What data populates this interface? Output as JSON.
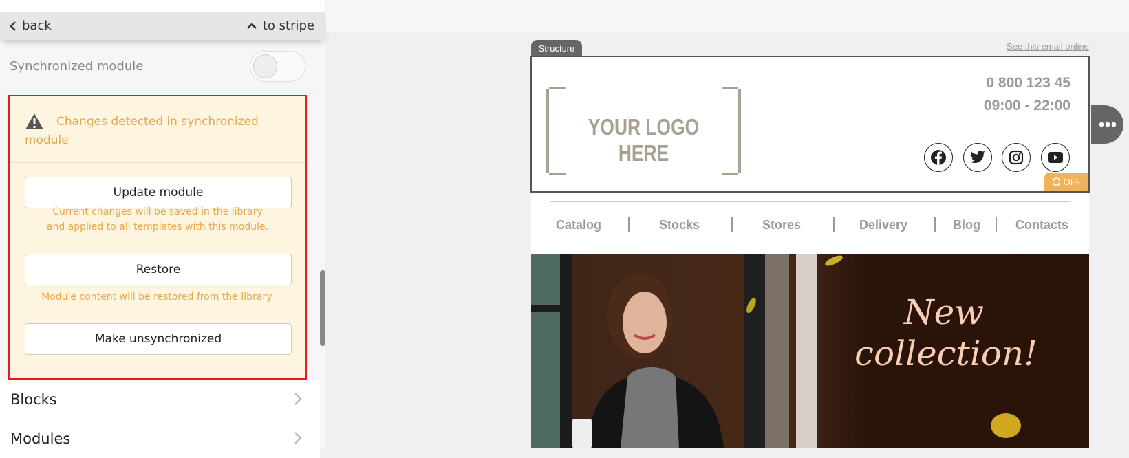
{
  "panel": {
    "back_label": "back",
    "to_stripe_label": "to stripe",
    "sync_label": "Synchronized module",
    "sync_enabled": false,
    "warning": {
      "title": "Changes detected in synchronized module",
      "update_label": "Update module",
      "update_desc": "Current changes will be saved in the library and applied to all templates with this module.",
      "restore_label": "Restore",
      "restore_desc": "Module content will be restored from the library.",
      "unsync_label": "Make unsynchronized"
    },
    "sections": [
      {
        "label": "Blocks"
      },
      {
        "label": "Modules"
      }
    ],
    "colors": {
      "warning_text": "#e2a94a",
      "highlight_border": "#e31c23",
      "warning_bg": "#fdf5e0"
    }
  },
  "email": {
    "structure_label": "Structure",
    "view_online": "See this email online",
    "logo_text": "YOUR LOGO HERE",
    "phone": "0 800 123 45",
    "hours": "09:00 - 22:00",
    "social": [
      "facebook-icon",
      "twitter-icon",
      "instagram-icon",
      "youtube-icon"
    ],
    "sync_badge": "OFF",
    "nav": [
      "Catalog",
      "Stocks",
      "Stores",
      "Delivery",
      "Blog",
      "Contacts"
    ],
    "hero_text_line1": "New",
    "hero_text_line2": "collection!",
    "colors": {
      "badge": "#f0b35a",
      "hero_text": "#f7cdb6"
    }
  }
}
